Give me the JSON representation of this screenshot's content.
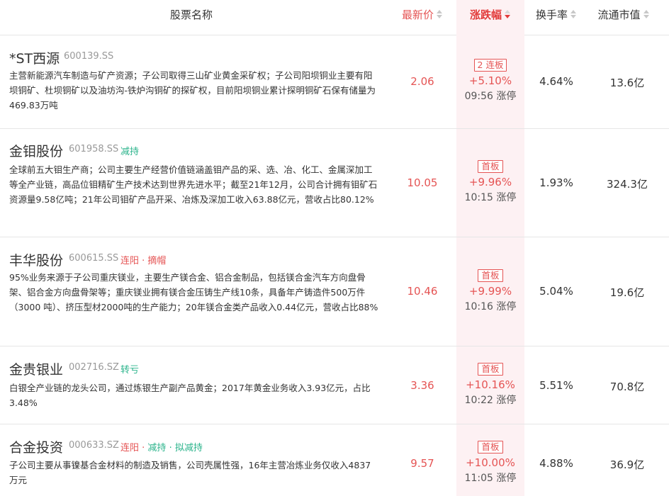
{
  "header": {
    "name": "股票名称",
    "price": "最新价",
    "change": "涨跌幅",
    "turnover": "换手率",
    "market_cap": "流通市值"
  },
  "rows": [
    {
      "name": "*ST西源",
      "code": "600139.SS",
      "tags": [],
      "desc": "主营新能源汽车制造与矿产资源；子公司取得三山矿业黄金采矿权；子公司阳坝铜业主要有阳坝铜矿、杜坝铜矿以及油坊沟-铁炉沟铜矿的探矿权，目前阳坝铜业累计探明铜矿石保有储量为469.83万吨",
      "price": "2.06",
      "badge": "2 连板",
      "pct": "+5.10%",
      "time": "09:56 涨停",
      "turnover": "4.64%",
      "cap": "13.6亿"
    },
    {
      "name": "金钼股份",
      "code": "601958.SS",
      "tags": [
        {
          "text": "减持",
          "color": "green"
        }
      ],
      "desc": "全球前五大钼生产商；公司主要生产经营价值链涵盖钼产品的采、选、冶、化工、金属深加工等全产业链，高品位钼精矿生产技术达到世界先进水平；截至21年12月，公司合计拥有钼矿石资源量9.58亿吨；21年公司钼矿产品开采、冶炼及深加工收入63.88亿元，营收占比80.12%",
      "price": "10.05",
      "badge": "首板",
      "pct": "+9.96%",
      "time": "10:15 涨停",
      "turnover": "1.93%",
      "cap": "324.3亿"
    },
    {
      "name": "丰华股份",
      "code": "600615.SS",
      "tags": [
        {
          "text": "连阳",
          "color": "red"
        },
        {
          "text": "摘帽",
          "color": "red"
        }
      ],
      "desc": "95%业务来源于子公司重庆镁业，主要生产镁合金、铝合金制品，包括镁合金汽车方向盘骨架、铝合金方向盘骨架等；重庆镁业拥有镁合金压铸生产线10条，具备年产铸造件500万件（3000 吨）、挤压型材2000吨的生产能力；20年镁合金类产品收入0.44亿元，营收占比88%",
      "price": "10.46",
      "badge": "首板",
      "pct": "+9.99%",
      "time": "10:16 涨停",
      "turnover": "5.04%",
      "cap": "19.6亿"
    },
    {
      "name": "金贵银业",
      "code": "002716.SZ",
      "tags": [
        {
          "text": "转亏",
          "color": "green"
        }
      ],
      "desc": "白银全产业链的龙头公司，通过炼银生产副产品黄金；2017年黄金业务收入3.93亿元，占比3.48%",
      "price": "3.36",
      "badge": "首板",
      "pct": "+10.16%",
      "time": "10:22 涨停",
      "turnover": "5.51%",
      "cap": "70.8亿"
    },
    {
      "name": "合金投资",
      "code": "000633.SZ",
      "tags": [
        {
          "text": "连阳",
          "color": "red"
        },
        {
          "text": "减持",
          "color": "green"
        },
        {
          "text": "拟减持",
          "color": "green"
        }
      ],
      "desc": "子公司主要从事镍基合金材料的制造及销售，公司壳属性强，16年主营冶炼业务仅收入4837万元",
      "price": "9.57",
      "badge": "首板",
      "pct": "+10.00%",
      "time": "11:05 涨停",
      "turnover": "4.88%",
      "cap": "36.9亿"
    }
  ],
  "colors": {
    "up_red": "#e55454",
    "tag_green": "#2ab38b",
    "highlight_col": "#fdf1f3"
  }
}
